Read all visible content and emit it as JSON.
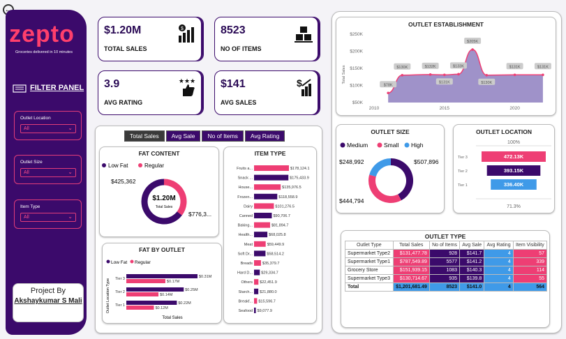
{
  "nav": {
    "back_icon": "back-arrow-icon"
  },
  "brand": {
    "logo": "zepto",
    "tagline": "Groceries delivered in 10 minutes",
    "panel_title": "FILTER PANEL"
  },
  "filters": [
    {
      "label": "Outlet Location",
      "value": "All"
    },
    {
      "label": "Outlet Size",
      "value": "All"
    },
    {
      "label": "Item Type",
      "value": "All"
    }
  ],
  "project": {
    "title": "Project By",
    "name": "Akshaykumar S Mali"
  },
  "kpis": [
    {
      "value": "$1.20M",
      "label": "TOTAL SALES",
      "icon": "money-growth-icon"
    },
    {
      "value": "8523",
      "label": "NO OF ITEMS",
      "icon": "boxes-icon"
    },
    {
      "value": "3.9",
      "label": "AVG RATING",
      "icon": "stars-thumbs-icon"
    },
    {
      "value": "$141",
      "label": "AVG SALES",
      "icon": "dollar-growth-icon"
    }
  ],
  "tabs": [
    "Total Sales",
    "Avg Sale",
    "No of Items",
    "Avg Rating"
  ],
  "colors": {
    "purple": "#3b0a6b",
    "pink": "#ee3e74",
    "blue": "#3f9ae8",
    "area": "#8e7fc0"
  },
  "fat_content": {
    "title": "FAT CONTENT",
    "legend": [
      "Low Fat",
      "Regular"
    ],
    "center_value": "$1.20M",
    "center_label": "Total Sales",
    "labels": [
      "$425,362",
      "$776,3..."
    ]
  },
  "item_type": {
    "title": "ITEM TYPE"
  },
  "fat_by_outlet": {
    "title": "FAT BY OUTLET",
    "legend": [
      "Low Fat",
      "Regular"
    ],
    "ylabel": "Outlet Location Type",
    "xlabel": "Total Sales"
  },
  "establishment": {
    "title": "OUTLET ESTABLISHMENT",
    "ylabel": "Total Sales"
  },
  "outlet_size": {
    "title": "OUTLET SIZE",
    "legend": [
      "Medium",
      "Small",
      "High"
    ],
    "labels": [
      "$248,992",
      "$507,896",
      "$444,794"
    ]
  },
  "outlet_location": {
    "title": "OUTLET LOCATION",
    "top": "100%",
    "bottom": "71.3%"
  },
  "outlet_type": {
    "title": "OUTLET TYPE",
    "headers": [
      "Outlet Type",
      "Total Sales",
      "No of Items",
      "Avg Sale",
      "Avg Rating",
      "Item Visibility"
    ],
    "rows": [
      [
        "Supermarket Type2",
        "$131,477.78",
        "928",
        "$141.7",
        "4",
        "57"
      ],
      [
        "Supermarket Type1",
        "$787,549.89",
        "5577",
        "$141.2",
        "4",
        "339"
      ],
      [
        "Grocery Store",
        "$151,939.15",
        "1083",
        "$140.3",
        "4",
        "114"
      ],
      [
        "Supermarket Type3",
        "$130,714.67",
        "935",
        "$139.8",
        "4",
        "55"
      ]
    ],
    "total": [
      "Total",
      "$1,201,681.49",
      "8523",
      "$141.0",
      "4",
      "564"
    ]
  },
  "chart_data": [
    {
      "type": "pie",
      "title": "FAT CONTENT",
      "categories": [
        "Low Fat",
        "Regular"
      ],
      "values": [
        425362,
        776320
      ]
    },
    {
      "type": "bar",
      "title": "ITEM TYPE",
      "categories": [
        "Fruits a...",
        "Snack ...",
        "House...",
        "Frozen...",
        "Dairy",
        "Canned",
        "Baking...",
        "Health...",
        "Meat",
        "Soft Dr...",
        "Breads",
        "Hard D...",
        "Others",
        "Starch...",
        "Breakf...",
        "Seafood"
      ],
      "values": [
        178124.1,
        175433.9,
        135976.5,
        118558.9,
        101276.5,
        90706.7,
        81894.7,
        68025.8,
        59449.9,
        58514.2,
        35379.7,
        29334.7,
        22451.9,
        21880.0,
        15596.7,
        9077.9
      ],
      "labels": [
        "$178,124.1",
        "$175,433.9",
        "$135,976.5",
        "$118,558.9",
        "$101,276.5",
        "$90,706.7",
        "$81,894.7",
        "$68,025.8",
        "$59,449.9",
        "$58,514.2",
        "$35,379.7",
        "$29,334.7",
        "$22,451.9",
        "$21,880.0",
        "$15,596.7",
        "$9,077.9"
      ]
    },
    {
      "type": "bar",
      "title": "FAT BY OUTLET",
      "categories": [
        "Tier 3",
        "Tier 2",
        "Tier 1"
      ],
      "series": [
        {
          "name": "Low Fat",
          "values": [
            0.31,
            0.25,
            0.22
          ],
          "labels": [
            "$0.31M",
            "$0.25M",
            "$0.22M"
          ]
        },
        {
          "name": "Regular",
          "values": [
            0.17,
            0.14,
            0.12
          ],
          "labels": [
            "$0.17M",
            "$0.14M",
            "$0.12M"
          ]
        }
      ]
    },
    {
      "type": "area",
      "title": "OUTLET ESTABLISHMENT",
      "x": [
        2011,
        2012,
        2014,
        2015,
        2016,
        2017,
        2018,
        2020,
        2022
      ],
      "values": [
        78,
        130,
        132,
        131,
        133,
        205,
        130,
        131,
        131
      ],
      "labels": [
        "$78K",
        "$130K",
        "$132K",
        "$131K",
        "$133K",
        "$205K",
        "$130K",
        "$131K",
        "$131K"
      ],
      "yticks": [
        "$50K",
        "$100K",
        "$150K",
        "$200K",
        "$250K"
      ],
      "xticks": [
        "2010",
        "2015",
        "2020"
      ],
      "ylim": [
        50,
        250
      ]
    },
    {
      "type": "pie",
      "title": "OUTLET SIZE",
      "categories": [
        "Medium",
        "Small",
        "High"
      ],
      "values": [
        507896,
        444794,
        248992
      ]
    },
    {
      "type": "bar",
      "title": "OUTLET LOCATION",
      "categories": [
        "Tier 3",
        "Tier 2",
        "Tier 1"
      ],
      "values": [
        472.13,
        393.15,
        336.4
      ],
      "labels": [
        "472.13K",
        "393.15K",
        "336.40K"
      ]
    }
  ]
}
